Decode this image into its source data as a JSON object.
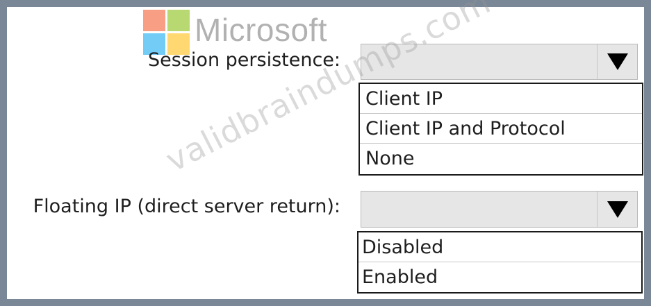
{
  "logo": {
    "text": "Microsoft"
  },
  "watermark": {
    "text": "validbraindumps.com"
  },
  "session_persistence": {
    "label": "Session persistence:",
    "options": [
      "Client IP",
      "Client IP and Protocol",
      "None"
    ]
  },
  "floating_ip": {
    "label": "Floating IP (direct server return):",
    "options": [
      "Disabled",
      "Enabled"
    ]
  },
  "icons": {
    "dropdown": "triangle-down-icon"
  },
  "colors": {
    "frame": "#7a8797",
    "combo_bg": "#e6e6e6"
  }
}
